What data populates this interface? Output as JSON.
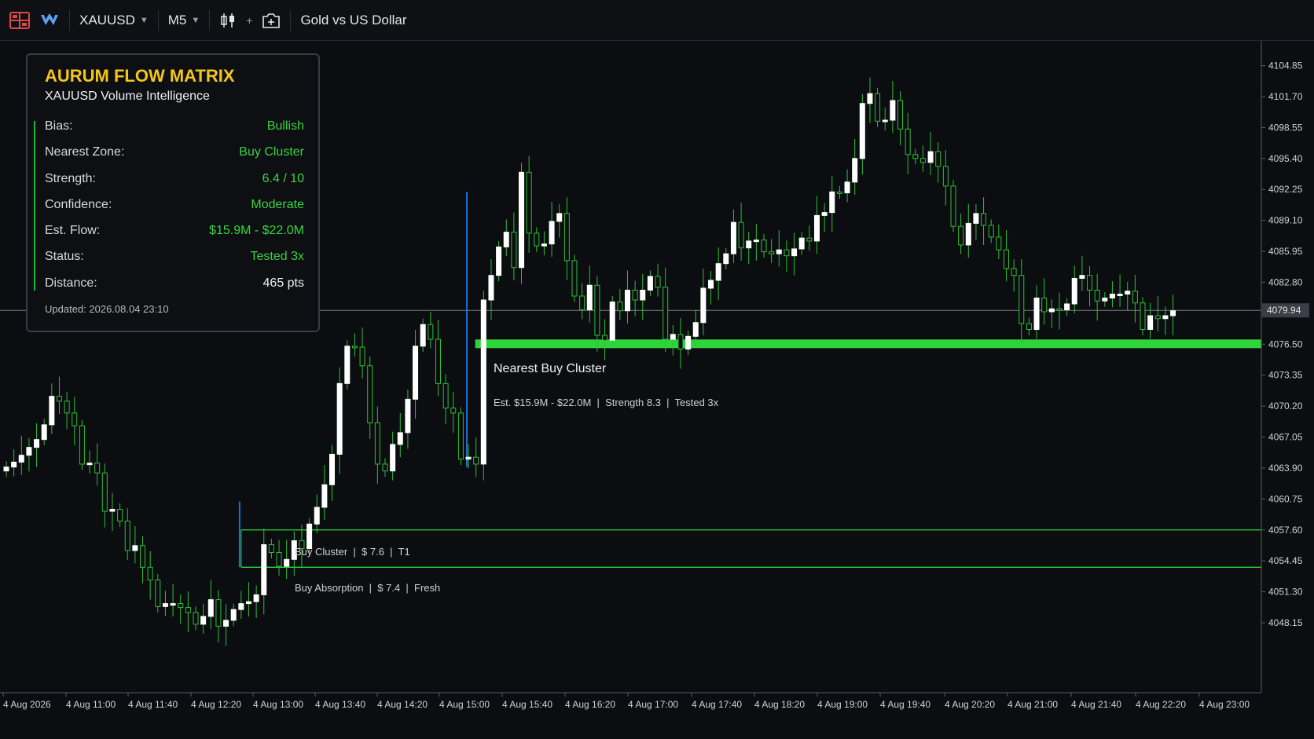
{
  "toolbar": {
    "symbol": "XAUUSD",
    "timeframe": "M5",
    "instrument_name": "Gold vs US Dollar"
  },
  "panel": {
    "title": "AURUM FLOW MATRIX",
    "subtitle": "XAUUSD Volume Intelligence",
    "rows": [
      {
        "label": "Bias:",
        "value": "Bullish"
      },
      {
        "label": "Nearest Zone:",
        "value": "Buy Cluster"
      },
      {
        "label": "Strength:",
        "value": "6.4 / 10"
      },
      {
        "label": "Confidence:",
        "value": "Moderate"
      },
      {
        "label": "Est. Flow:",
        "value": "$15.9M - $22.0M"
      },
      {
        "label": "Status:",
        "value": "Tested 3x"
      },
      {
        "label": "Distance:",
        "value": "465 pts"
      }
    ],
    "updated": "Updated: 2026.08.04 23:10"
  },
  "annotations": {
    "nearest_title": "Nearest Buy Cluster",
    "nearest_detail": "Est. $15.9M - $22.0M  |  Strength 8.3  |  Tested 3x",
    "cluster_label": "Buy Cluster  |  $ 7.6  |  T1",
    "absorption_label": "Buy Absorption  |  $ 7.4  |  Fresh"
  },
  "colors": {
    "background": "#0b0d10",
    "bull_candle": "#ffffff",
    "wick": "#2fbf36",
    "zone_green": "#2fd43a",
    "title_gold": "#f5c518",
    "value_green": "#37d43f",
    "marker_blue": "#1e6fd9"
  },
  "chart_data": {
    "type": "candlestick",
    "price_labels": [
      "4104.85",
      "4101.70",
      "4098.55",
      "4095.40",
      "4092.25",
      "4089.10",
      "4085.95",
      "4082.80",
      "4076.50",
      "4073.35",
      "4070.20",
      "4067.05",
      "4063.90",
      "4060.75",
      "4057.60",
      "4054.45",
      "4051.30",
      "4048.15"
    ],
    "ylim": [
      4043.5,
      4108
    ],
    "current_price": "4079.94",
    "time_labels": [
      "4 Aug 2026",
      "4 Aug 11:00",
      "4 Aug 11:40",
      "4 Aug 12:20",
      "4 Aug 13:00",
      "4 Aug 13:40",
      "4 Aug 14:20",
      "4 Aug 15:00",
      "4 Aug 15:40",
      "4 Aug 16:20",
      "4 Aug 17:00",
      "4 Aug 17:40",
      "4 Aug 18:20",
      "4 Aug 19:00",
      "4 Aug 19:40",
      "4 Aug 20:20",
      "4 Aug 21:00",
      "4 Aug 21:40",
      "4 Aug 22:20",
      "4 Aug 23:00"
    ],
    "nearest_zone": {
      "price": 4076.5,
      "start_bar": 62
    },
    "cluster_zone": {
      "top": 4057.6,
      "bottom": 4053.8,
      "start_bar": 31
    },
    "markers": [
      {
        "bar": 31,
        "top": 4060.5,
        "bottom": 4053.8
      },
      {
        "bar": 61,
        "top": 4092.0,
        "bottom": 4064.0
      }
    ],
    "closes": [
      4064.0,
      4064.5,
      4065.2,
      4066.0,
      4066.8,
      4068.3,
      4071.2,
      4070.7,
      4069.5,
      4068.2,
      4064.3,
      4064.4,
      4063.4,
      4059.5,
      4059.7,
      4058.5,
      4055.5,
      4056.0,
      4053.8,
      4052.5,
      4049.8,
      4050.1,
      4050.1,
      4049.7,
      4049.2,
      4048.0,
      4048.8,
      4050.5,
      4047.8,
      4048.4,
      4049.5,
      4050.1,
      4050.3,
      4051.0,
      4056.1,
      4055.3,
      4053.9,
      4054.6,
      4056.5,
      4055.7,
      4058.2,
      4059.9,
      4062.2,
      4065.3,
      4072.5,
      4076.3,
      4076.2,
      4074.3,
      4068.5,
      4064.3,
      4063.6,
      4066.3,
      4067.5,
      4070.9,
      4076.3,
      4078.5,
      4077.0,
      4072.5,
      4070.0,
      4069.5,
      4064.8,
      4065.0,
      4064.3,
      4081.0,
      4083.5,
      4086.4,
      4087.9,
      4084.3,
      4094.0,
      4087.8,
      4086.5,
      4086.7,
      4089.0,
      4089.8,
      4085.0,
      4081.4,
      4080.0,
      4082.5,
      4077.4,
      4076.9,
      4080.8,
      4079.9,
      4082.0,
      4081.0,
      4082.0,
      4083.4,
      4082.3,
      4077.0,
      4077.5,
      4076.0,
      4077.3,
      4078.7,
      4082.2,
      4083.0,
      4084.7,
      4085.7,
      4088.9,
      4086.3,
      4087.0,
      4087.1,
      4085.9,
      4085.7,
      4086.1,
      4085.5,
      4086.2,
      4087.3,
      4087.0,
      4089.6,
      4089.9,
      4092.0,
      4091.9,
      4093.0,
      4095.4,
      4101.0,
      4102.0,
      4099.2,
      4099.3,
      4101.3,
      4098.4,
      4095.8,
      4095.4,
      4095.0,
      4096.1,
      4094.6,
      4092.6,
      4088.5,
      4086.6,
      4088.8,
      4089.8,
      4088.6,
      4087.4,
      4086.1,
      4084.2,
      4083.5,
      4078.6,
      4078.0,
      4081.2,
      4079.8,
      4080.1,
      4080.0,
      4080.6,
      4083.2,
      4083.5,
      4082.0,
      4080.9,
      4081.2,
      4081.6,
      4081.6,
      4081.9,
      4080.7,
      4078.0,
      4079.4,
      4079.1,
      4079.4,
      4079.9
    ]
  }
}
